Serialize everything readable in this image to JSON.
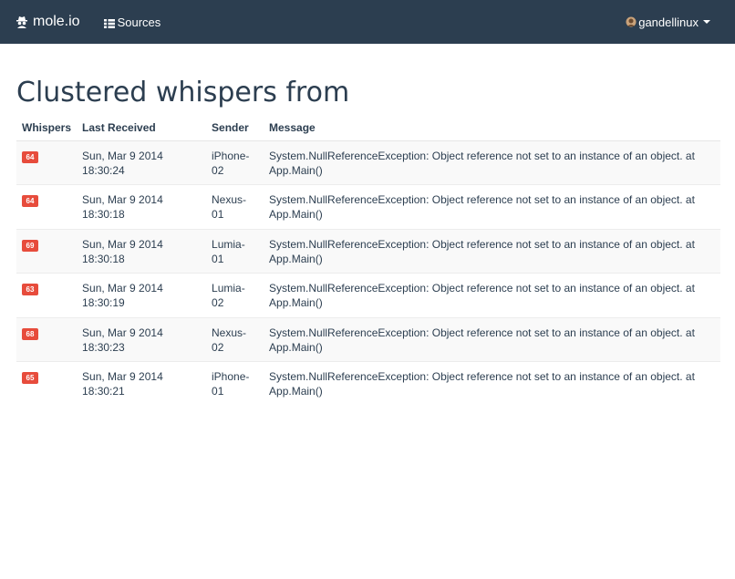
{
  "navbar": {
    "brand": "mole.io",
    "brand_icon": "spy-icon",
    "sources_label": "Sources",
    "sources_icon": "grid-icon",
    "user": "gandellinux",
    "user_icon": "avatar"
  },
  "page": {
    "title": "Clustered whispers from"
  },
  "table": {
    "headers": {
      "whispers": "Whispers",
      "received": "Last Received",
      "sender": "Sender",
      "message": "Message"
    },
    "badge_color": "#e74c3c",
    "rows": [
      {
        "count": "64",
        "date": "Sun, Mar 9 2014",
        "time": "18:30:24",
        "sender_a": "iPhone-",
        "sender_b": "02",
        "message": "System.NullReferenceException: Object reference not set to an instance of an object. at App.Main()"
      },
      {
        "count": "64",
        "date": "Sun, Mar 9 2014",
        "time": "18:30:18",
        "sender_a": "Nexus-",
        "sender_b": "01",
        "message": "System.NullReferenceException: Object reference not set to an instance of an object. at App.Main()"
      },
      {
        "count": "69",
        "date": "Sun, Mar 9 2014",
        "time": "18:30:18",
        "sender_a": "Lumia-",
        "sender_b": "01",
        "message": "System.NullReferenceException: Object reference not set to an instance of an object. at App.Main()"
      },
      {
        "count": "63",
        "date": "Sun, Mar 9 2014",
        "time": "18:30:19",
        "sender_a": "Lumia-",
        "sender_b": "02",
        "message": "System.NullReferenceException: Object reference not set to an instance of an object. at App.Main()"
      },
      {
        "count": "68",
        "date": "Sun, Mar 9 2014",
        "time": "18:30:23",
        "sender_a": "Nexus-",
        "sender_b": "02",
        "message": "System.NullReferenceException: Object reference not set to an instance of an object. at App.Main()"
      },
      {
        "count": "65",
        "date": "Sun, Mar 9 2014",
        "time": "18:30:21",
        "sender_a": "iPhone-",
        "sender_b": "01",
        "message": "System.NullReferenceException: Object reference not set to an instance of an object. at App.Main()"
      }
    ]
  }
}
